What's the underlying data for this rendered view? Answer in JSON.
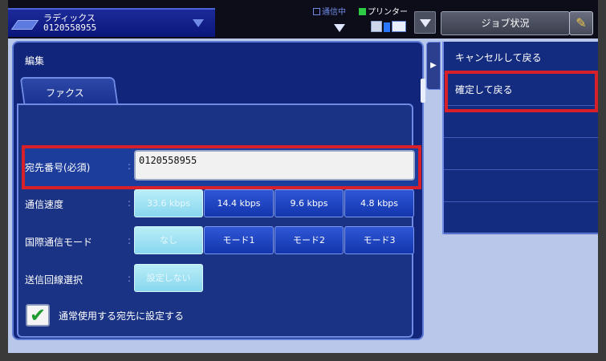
{
  "header": {
    "destination_name": "ラディックス",
    "destination_number": "0120558955",
    "comm_status": "通信中",
    "printer_status": "プリンター",
    "job_status_label": "ジョブ状況"
  },
  "panel": {
    "title": "編集",
    "tab_label": "ファクス"
  },
  "form": {
    "destination_label": "宛先番号(必須)",
    "destination_value": "0120558955",
    "speed_label": "通信速度",
    "speed_options": [
      "33.6 kbps",
      "14.4 kbps",
      "9.6 kbps",
      "4.8 kbps"
    ],
    "speed_selected": "33.6 kbps",
    "intl_label": "国際通信モード",
    "intl_options": [
      "なし",
      "モード1",
      "モード2",
      "モード3"
    ],
    "intl_selected": "なし",
    "line_label": "送信回線選択",
    "line_value": "設定しない",
    "default_checkbox_label": "通常使用する宛先に設定する",
    "default_checked": true
  },
  "side_menu": {
    "items": [
      "キャンセルして戻る",
      "確定して戻る",
      "",
      "",
      "",
      ""
    ]
  },
  "colors": {
    "panel_bg": "#11267a",
    "button_blue": "#1336ad",
    "selected_cyan": "#88d6ee",
    "highlight_red": "#d8202a"
  }
}
